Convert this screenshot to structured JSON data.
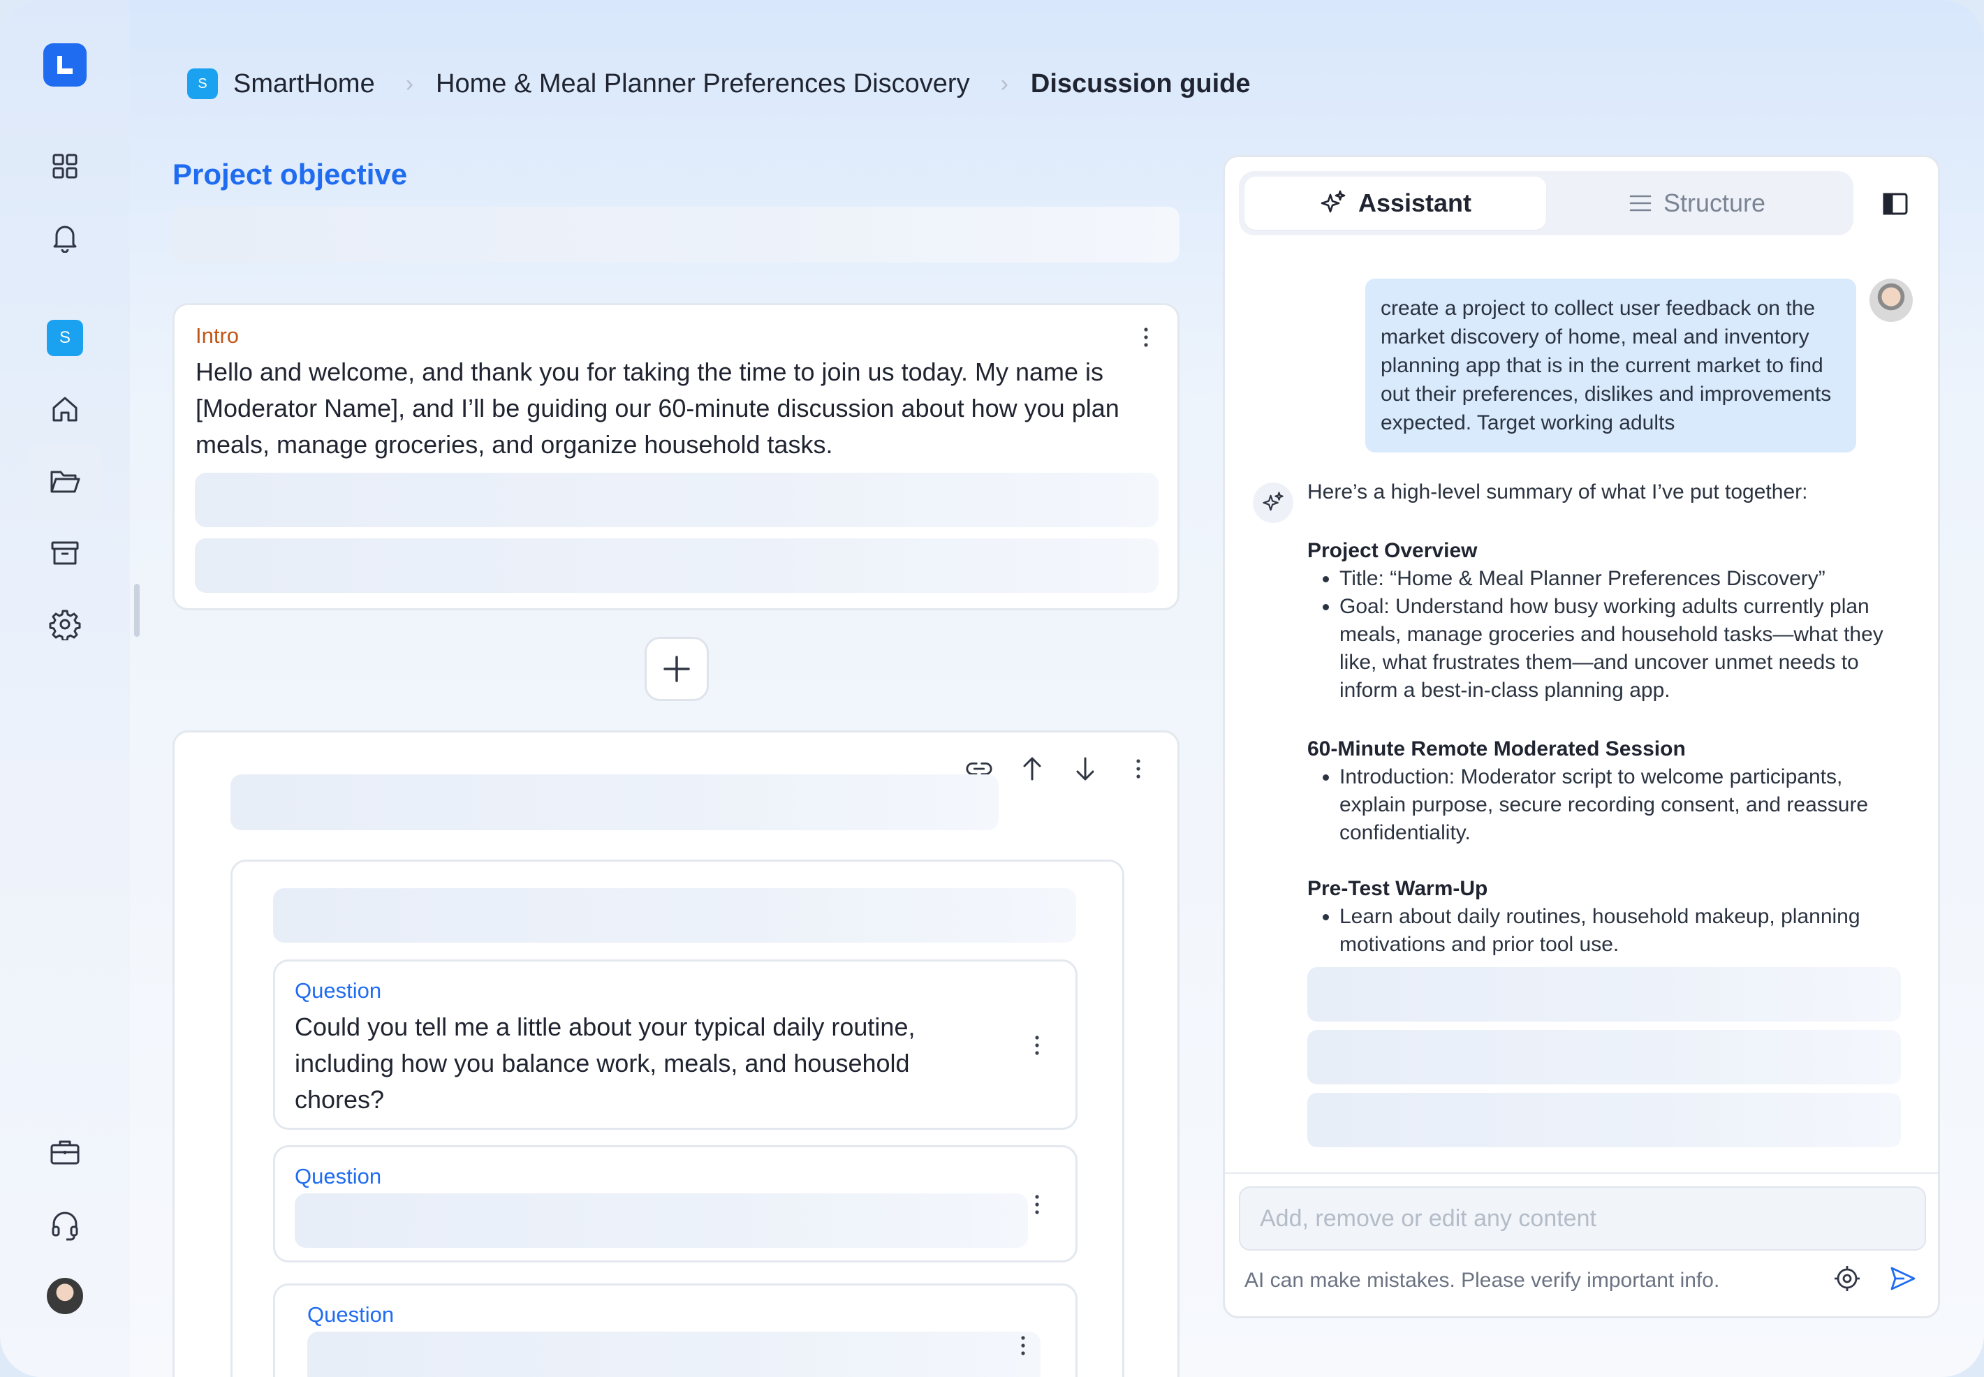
{
  "breadcrumb": {
    "workspace_badge": "S",
    "workspace": "SmartHome",
    "project": "Home & Meal Planner Preferences Discovery",
    "current": "Discussion guide"
  },
  "rail": {
    "workspace_badge": "S",
    "icons": [
      "dashboard-icon",
      "bell-icon",
      "home-icon",
      "folder-icon",
      "archive-icon",
      "gear-icon",
      "briefcase-icon",
      "headset-icon"
    ]
  },
  "objective": {
    "title": "Project objective"
  },
  "intro_card": {
    "label": "Intro",
    "text": "Hello and welcome, and thank you for taking the time to join us today. My name is [Moderator Name], and I’ll be guiding our 60-minute discussion about how you plan meals, manage groceries, and organize household tasks."
  },
  "questions": [
    {
      "label": "Question",
      "text": "Could you tell me a little about your typical daily routine, including how you balance work, meals, and household chores?"
    },
    {
      "label": "Question",
      "text": ""
    },
    {
      "label": "Question",
      "text": ""
    }
  ],
  "assistant": {
    "tabs": [
      {
        "label": "Assistant",
        "icon": "sparkle-icon",
        "active": true
      },
      {
        "label": "Structure",
        "icon": "list-icon",
        "active": false
      }
    ],
    "user_message": "create a project to collect user feedback on the market discovery of home, meal and inventory planning app that is in the current market to find out their preferences, dislikes and improvements expected. Target working adults",
    "ai_intro": "Here’s a high-level summary of what I’ve put together:",
    "sections": [
      {
        "heading": "Project Overview",
        "bullets": [
          "Title: “Home & Meal Planner Preferences Discovery”",
          "Goal: Understand how busy working adults currently plan meals, manage groceries and household tasks—what they like, what frustrates them—and uncover unmet needs to inform a best-in-class planning app."
        ]
      },
      {
        "heading": "60-Minute Remote Moderated Session",
        "bullets": [
          "Introduction: Moderator script to welcome participants, explain purpose, secure recording consent, and reassure confidentiality."
        ]
      },
      {
        "heading": "Pre-Test Warm-Up",
        "bullets": [
          "Learn about daily routines, household makeup, planning motivations and prior tool use."
        ]
      }
    ],
    "input_placeholder": "Add, remove or edit any content",
    "disclaimer": "AI can make mistakes. Please verify important info."
  },
  "colors": {
    "accent": "#1f6cf0",
    "intro_label": "#c0571a",
    "badge": "#1aa2f0",
    "user_bubble": "#d9eafd"
  }
}
